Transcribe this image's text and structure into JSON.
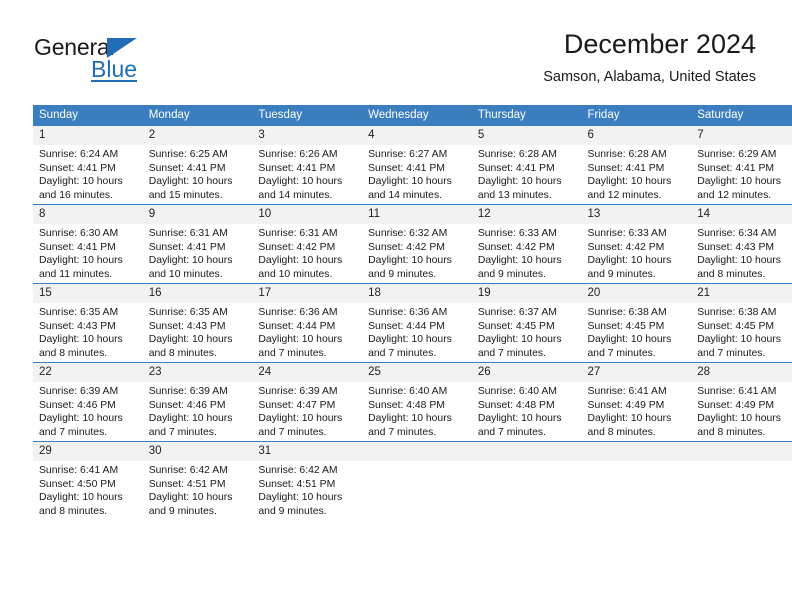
{
  "logo": {
    "word_dark": "General",
    "word_blue": "Blue",
    "brand_blue": "#1f6eb5"
  },
  "header": {
    "title": "December 2024",
    "subtitle": "Samson, Alabama, United States"
  },
  "calendar": {
    "header_bg": "#3a7ebf",
    "daynum_bg": "#f2f2f2",
    "weekday_headers": [
      "Sunday",
      "Monday",
      "Tuesday",
      "Wednesday",
      "Thursday",
      "Friday",
      "Saturday"
    ],
    "weeks": [
      [
        {
          "day": "1",
          "sunrise": "Sunrise: 6:24 AM",
          "sunset": "Sunset: 4:41 PM",
          "daylight1": "Daylight: 10 hours",
          "daylight2": "and 16 minutes."
        },
        {
          "day": "2",
          "sunrise": "Sunrise: 6:25 AM",
          "sunset": "Sunset: 4:41 PM",
          "daylight1": "Daylight: 10 hours",
          "daylight2": "and 15 minutes."
        },
        {
          "day": "3",
          "sunrise": "Sunrise: 6:26 AM",
          "sunset": "Sunset: 4:41 PM",
          "daylight1": "Daylight: 10 hours",
          "daylight2": "and 14 minutes."
        },
        {
          "day": "4",
          "sunrise": "Sunrise: 6:27 AM",
          "sunset": "Sunset: 4:41 PM",
          "daylight1": "Daylight: 10 hours",
          "daylight2": "and 14 minutes."
        },
        {
          "day": "5",
          "sunrise": "Sunrise: 6:28 AM",
          "sunset": "Sunset: 4:41 PM",
          "daylight1": "Daylight: 10 hours",
          "daylight2": "and 13 minutes."
        },
        {
          "day": "6",
          "sunrise": "Sunrise: 6:28 AM",
          "sunset": "Sunset: 4:41 PM",
          "daylight1": "Daylight: 10 hours",
          "daylight2": "and 12 minutes."
        },
        {
          "day": "7",
          "sunrise": "Sunrise: 6:29 AM",
          "sunset": "Sunset: 4:41 PM",
          "daylight1": "Daylight: 10 hours",
          "daylight2": "and 12 minutes."
        }
      ],
      [
        {
          "day": "8",
          "sunrise": "Sunrise: 6:30 AM",
          "sunset": "Sunset: 4:41 PM",
          "daylight1": "Daylight: 10 hours",
          "daylight2": "and 11 minutes."
        },
        {
          "day": "9",
          "sunrise": "Sunrise: 6:31 AM",
          "sunset": "Sunset: 4:41 PM",
          "daylight1": "Daylight: 10 hours",
          "daylight2": "and 10 minutes."
        },
        {
          "day": "10",
          "sunrise": "Sunrise: 6:31 AM",
          "sunset": "Sunset: 4:42 PM",
          "daylight1": "Daylight: 10 hours",
          "daylight2": "and 10 minutes."
        },
        {
          "day": "11",
          "sunrise": "Sunrise: 6:32 AM",
          "sunset": "Sunset: 4:42 PM",
          "daylight1": "Daylight: 10 hours",
          "daylight2": "and 9 minutes."
        },
        {
          "day": "12",
          "sunrise": "Sunrise: 6:33 AM",
          "sunset": "Sunset: 4:42 PM",
          "daylight1": "Daylight: 10 hours",
          "daylight2": "and 9 minutes."
        },
        {
          "day": "13",
          "sunrise": "Sunrise: 6:33 AM",
          "sunset": "Sunset: 4:42 PM",
          "daylight1": "Daylight: 10 hours",
          "daylight2": "and 9 minutes."
        },
        {
          "day": "14",
          "sunrise": "Sunrise: 6:34 AM",
          "sunset": "Sunset: 4:43 PM",
          "daylight1": "Daylight: 10 hours",
          "daylight2": "and 8 minutes."
        }
      ],
      [
        {
          "day": "15",
          "sunrise": "Sunrise: 6:35 AM",
          "sunset": "Sunset: 4:43 PM",
          "daylight1": "Daylight: 10 hours",
          "daylight2": "and 8 minutes."
        },
        {
          "day": "16",
          "sunrise": "Sunrise: 6:35 AM",
          "sunset": "Sunset: 4:43 PM",
          "daylight1": "Daylight: 10 hours",
          "daylight2": "and 8 minutes."
        },
        {
          "day": "17",
          "sunrise": "Sunrise: 6:36 AM",
          "sunset": "Sunset: 4:44 PM",
          "daylight1": "Daylight: 10 hours",
          "daylight2": "and 7 minutes."
        },
        {
          "day": "18",
          "sunrise": "Sunrise: 6:36 AM",
          "sunset": "Sunset: 4:44 PM",
          "daylight1": "Daylight: 10 hours",
          "daylight2": "and 7 minutes."
        },
        {
          "day": "19",
          "sunrise": "Sunrise: 6:37 AM",
          "sunset": "Sunset: 4:45 PM",
          "daylight1": "Daylight: 10 hours",
          "daylight2": "and 7 minutes."
        },
        {
          "day": "20",
          "sunrise": "Sunrise: 6:38 AM",
          "sunset": "Sunset: 4:45 PM",
          "daylight1": "Daylight: 10 hours",
          "daylight2": "and 7 minutes."
        },
        {
          "day": "21",
          "sunrise": "Sunrise: 6:38 AM",
          "sunset": "Sunset: 4:45 PM",
          "daylight1": "Daylight: 10 hours",
          "daylight2": "and 7 minutes."
        }
      ],
      [
        {
          "day": "22",
          "sunrise": "Sunrise: 6:39 AM",
          "sunset": "Sunset: 4:46 PM",
          "daylight1": "Daylight: 10 hours",
          "daylight2": "and 7 minutes."
        },
        {
          "day": "23",
          "sunrise": "Sunrise: 6:39 AM",
          "sunset": "Sunset: 4:46 PM",
          "daylight1": "Daylight: 10 hours",
          "daylight2": "and 7 minutes."
        },
        {
          "day": "24",
          "sunrise": "Sunrise: 6:39 AM",
          "sunset": "Sunset: 4:47 PM",
          "daylight1": "Daylight: 10 hours",
          "daylight2": "and 7 minutes."
        },
        {
          "day": "25",
          "sunrise": "Sunrise: 6:40 AM",
          "sunset": "Sunset: 4:48 PM",
          "daylight1": "Daylight: 10 hours",
          "daylight2": "and 7 minutes."
        },
        {
          "day": "26",
          "sunrise": "Sunrise: 6:40 AM",
          "sunset": "Sunset: 4:48 PM",
          "daylight1": "Daylight: 10 hours",
          "daylight2": "and 7 minutes."
        },
        {
          "day": "27",
          "sunrise": "Sunrise: 6:41 AM",
          "sunset": "Sunset: 4:49 PM",
          "daylight1": "Daylight: 10 hours",
          "daylight2": "and 8 minutes."
        },
        {
          "day": "28",
          "sunrise": "Sunrise: 6:41 AM",
          "sunset": "Sunset: 4:49 PM",
          "daylight1": "Daylight: 10 hours",
          "daylight2": "and 8 minutes."
        }
      ],
      [
        {
          "day": "29",
          "sunrise": "Sunrise: 6:41 AM",
          "sunset": "Sunset: 4:50 PM",
          "daylight1": "Daylight: 10 hours",
          "daylight2": "and 8 minutes."
        },
        {
          "day": "30",
          "sunrise": "Sunrise: 6:42 AM",
          "sunset": "Sunset: 4:51 PM",
          "daylight1": "Daylight: 10 hours",
          "daylight2": "and 9 minutes."
        },
        {
          "day": "31",
          "sunrise": "Sunrise: 6:42 AM",
          "sunset": "Sunset: 4:51 PM",
          "daylight1": "Daylight: 10 hours",
          "daylight2": "and 9 minutes."
        },
        {
          "day": "",
          "sunrise": "",
          "sunset": "",
          "daylight1": "",
          "daylight2": ""
        },
        {
          "day": "",
          "sunrise": "",
          "sunset": "",
          "daylight1": "",
          "daylight2": ""
        },
        {
          "day": "",
          "sunrise": "",
          "sunset": "",
          "daylight1": "",
          "daylight2": ""
        },
        {
          "day": "",
          "sunrise": "",
          "sunset": "",
          "daylight1": "",
          "daylight2": ""
        }
      ]
    ]
  }
}
